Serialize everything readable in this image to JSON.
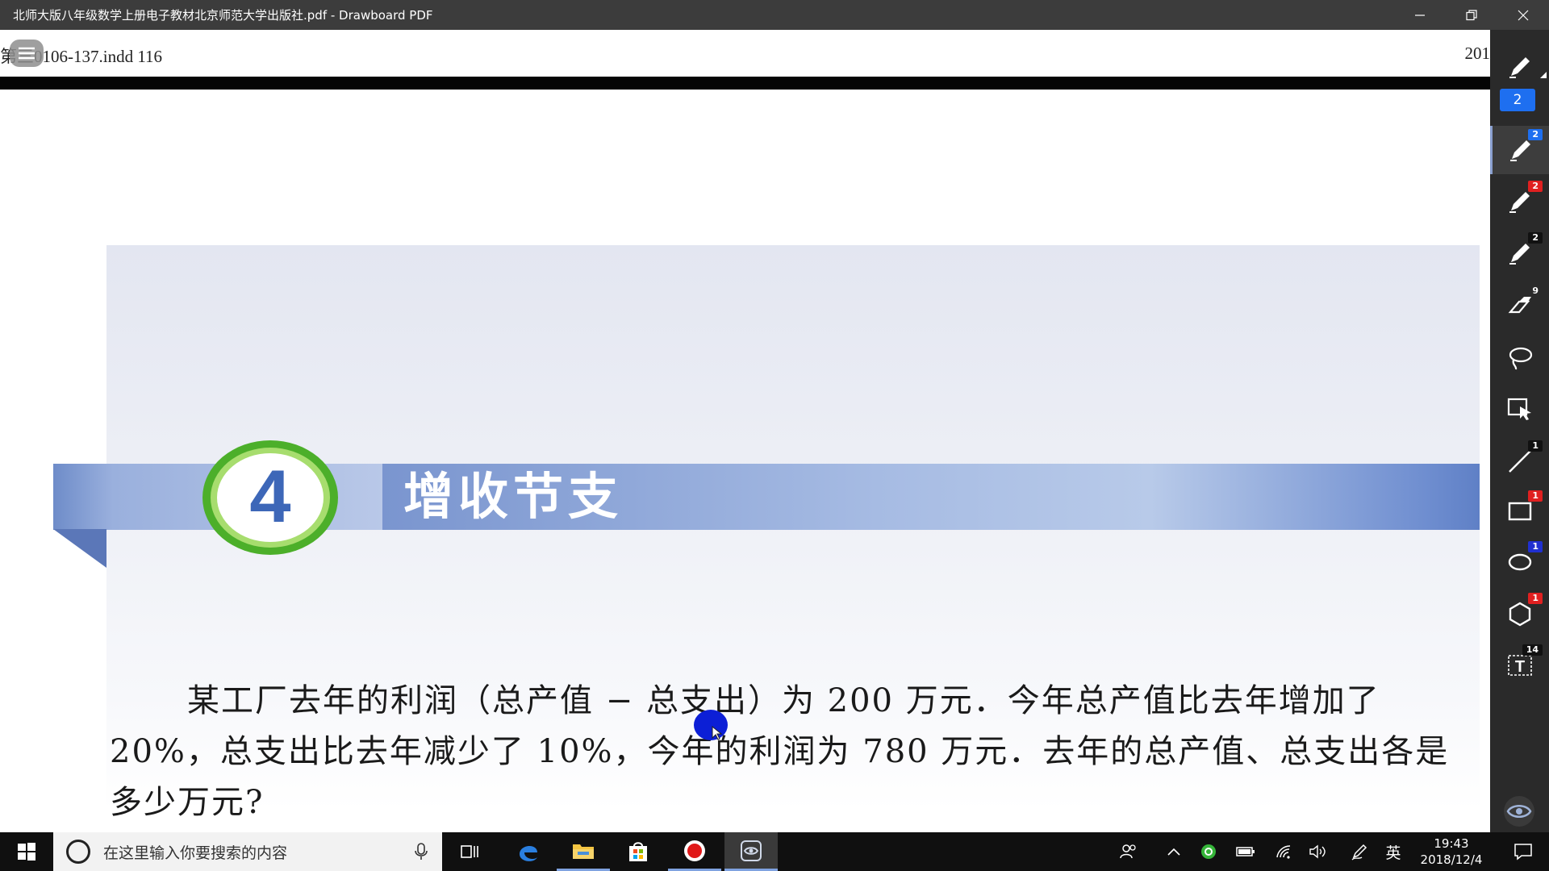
{
  "window": {
    "title": "北师大版八年级数学上册电子教材北京师范大学出版社.pdf - Drawboard PDF",
    "minimize_label": "minimize",
    "restore_label": "restore",
    "close_label": "close"
  },
  "document": {
    "header_left": "第三0106-137.indd   116",
    "header_right": "201",
    "section_number": "4",
    "section_title": "增收节支",
    "body_text": "某工厂去年的利润（总产值 − 总支出）为 200 万元．今年总产值比去年增加了 20%，总支出比去年减少了 10%，今年的利润为 780 万元．去年的总产值、总支出各是多少万元?"
  },
  "toolbar": {
    "page_count": "2",
    "tools": [
      {
        "name": "pen-tool-active",
        "icon": "pen-icon",
        "badge": "2",
        "badge_color": "#1e6ff0"
      },
      {
        "name": "pen-tool-red",
        "icon": "pen-icon",
        "badge": "2",
        "badge_color": "#e02020"
      },
      {
        "name": "pen-tool-black",
        "icon": "pen-icon",
        "badge": "2",
        "badge_color": "#111111"
      },
      {
        "name": "eraser-tool",
        "icon": "eraser-icon",
        "badge": "9",
        "badge_color": "#2a2a2a"
      },
      {
        "name": "lasso-tool",
        "icon": "lasso-icon",
        "badge": "",
        "badge_color": ""
      },
      {
        "name": "select-tool",
        "icon": "select-icon",
        "badge": "",
        "badge_color": ""
      },
      {
        "name": "line-tool",
        "icon": "line-icon",
        "badge": "1",
        "badge_color": "#111111"
      },
      {
        "name": "rectangle-tool",
        "icon": "rectangle-icon",
        "badge": "1",
        "badge_color": "#e02020"
      },
      {
        "name": "ellipse-tool",
        "icon": "ellipse-icon",
        "badge": "1",
        "badge_color": "#2030d0"
      },
      {
        "name": "polygon-tool",
        "icon": "hexagon-icon",
        "badge": "1",
        "badge_color": "#e02020"
      },
      {
        "name": "text-tool",
        "icon": "text-icon",
        "badge": "14",
        "badge_color": "#111111"
      }
    ]
  },
  "taskbar": {
    "search_placeholder": "在这里输入你要搜索的内容",
    "ime_label": "英",
    "time": "19:43",
    "date": "2018/12/4"
  },
  "colors": {
    "accent_blue": "#1e6ff0",
    "banner_blue": "#7a95cf",
    "circle_green": "#4caf2a"
  }
}
